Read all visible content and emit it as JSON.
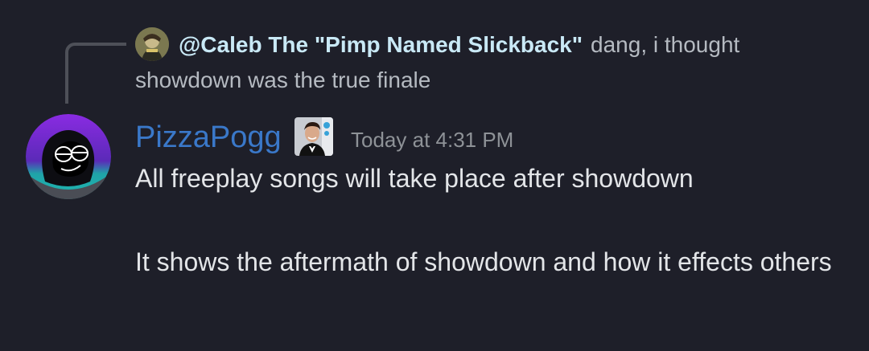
{
  "reply": {
    "author": "@Caleb The \"Pimp Named Slickback\"",
    "text_line1": "dang, i thought",
    "text_line2": "showdown was the true finale"
  },
  "message": {
    "username": "PizzaPogg",
    "timestamp": "Today at 4:31 PM",
    "paragraphs": [
      "All freeplay songs will take place after showdown",
      "It shows the aftermath of showdown and how it effects others"
    ]
  },
  "colors": {
    "background": "#1e1f29",
    "username": "#3a78c9",
    "reply_author": "#c9e9f6",
    "text": "#e3e5e8",
    "muted": "#8e9297"
  },
  "icons": {
    "reply_avatar": "user-avatar-icon",
    "main_avatar": "user-avatar-icon",
    "role_icon": "role-badge-icon"
  }
}
